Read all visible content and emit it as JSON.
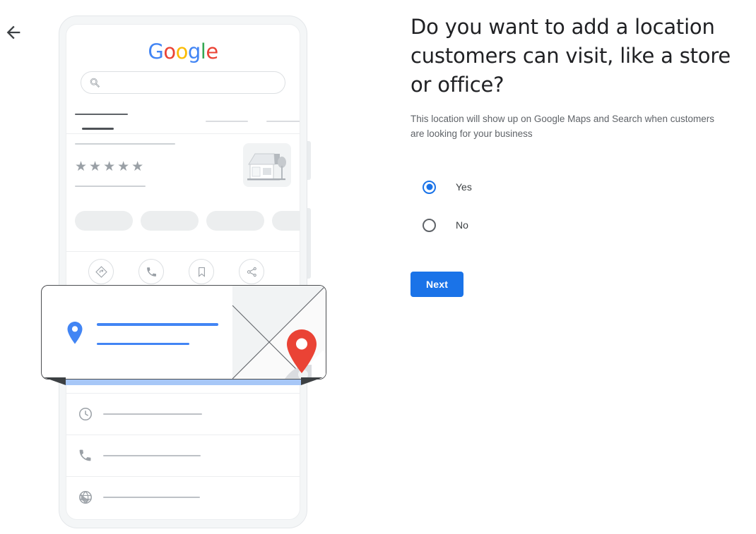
{
  "nav": {
    "back_label": "Back",
    "back_icon": "arrow-left-icon"
  },
  "panel": {
    "heading": "Do you want to add a location customers can visit, like a store or office?",
    "subtitle": "This location will show up on Google Maps and Search when customers are looking for your business",
    "options": [
      {
        "label": "Yes",
        "value": "yes",
        "selected": true
      },
      {
        "label": "No",
        "value": "no",
        "selected": false
      }
    ],
    "next_label": "Next"
  },
  "illustration": {
    "name": "google-business-profile-phone-mockup",
    "brand": {
      "logo_text": "Google",
      "logo_letters": [
        {
          "char": "G",
          "color": "#4285f4"
        },
        {
          "char": "o",
          "color": "#ea4335"
        },
        {
          "char": "o",
          "color": "#fbbc05"
        },
        {
          "char": "g",
          "color": "#4285f4"
        },
        {
          "char": "l",
          "color": "#34a853"
        },
        {
          "char": "e",
          "color": "#ea4335"
        }
      ]
    },
    "search": {
      "icon": "search-icon",
      "placeholder": ""
    },
    "rating": {
      "stars": "★★★★★",
      "star_count": 5
    },
    "business_thumbnail_icon": "storefront-icon",
    "action_icons": [
      "directions-icon",
      "call-icon",
      "save-bookmark-icon",
      "share-icon"
    ],
    "detail_rows": [
      {
        "icon": "clock-icon"
      },
      {
        "icon": "phone-icon"
      },
      {
        "icon": "globe-icon"
      }
    ],
    "map_card": {
      "pin_icon": "location-pin-icon",
      "map_marker_icon": "map-marker-icon"
    }
  },
  "colors": {
    "accent_blue": "#1a73e8",
    "pin_blue": "#4285f4",
    "marker_red": "#ea4335",
    "google_yellow": "#fbbc05",
    "google_green": "#34a853",
    "bar_blue": "#a7c7f7",
    "text_primary": "#202124",
    "text_secondary": "#5f6368",
    "placeholder_gray": "#cdd1d5",
    "frame_gray": "#f4f6f7"
  }
}
